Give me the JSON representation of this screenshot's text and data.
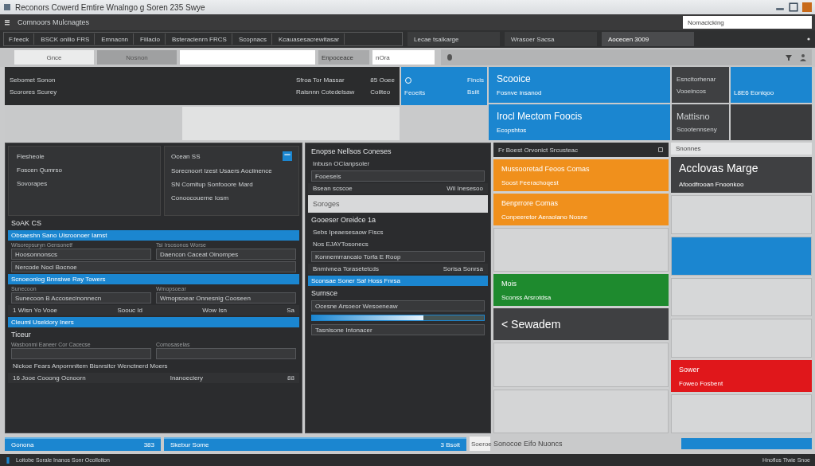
{
  "window": {
    "title": "Reconors Cowerd Emtire Wnalngo g Soren 235 Swye"
  },
  "app_bar": {
    "title": "Comnoors Mulcnagtes",
    "search": {
      "value": "Nomacicking"
    }
  },
  "toolbar": {
    "items": [
      "F.feeck",
      "BSCK onilio FRS",
      "Emnacnn",
      "Fiilacio",
      "Bsteracienrn FRCS",
      "Scopnacs",
      "Kcauasesacrewitasar"
    ],
    "tabs": [
      {
        "label": "Lecae tsalkarge",
        "selected": false
      },
      {
        "label": "Wrasoer Sacsa",
        "selected": false
      },
      {
        "label": "Aocecen 3009",
        "selected": true
      }
    ]
  },
  "filter_row": {
    "tabs": [
      {
        "label": "Gnce",
        "selected": true
      },
      {
        "label": "Nosnon",
        "selected": false
      }
    ],
    "field_label": "Enpoceace",
    "field_value": "nOra"
  },
  "info_panel": {
    "left": [
      "Sebomet Sonon",
      "Scorores Scurey"
    ],
    "middle": [
      "Sfroa Tor Massar",
      "Raisnnn Cotedelsaw"
    ],
    "right": [
      "85 Ooee",
      "Coilteo"
    ]
  },
  "side_tile": {
    "label": "Feoeits",
    "lines": [
      "Fincis",
      "Bsiit"
    ]
  },
  "blue_tiles": [
    {
      "title": "Scooice",
      "subtitle": "Fosnve insanod"
    },
    {
      "title": "Irocl Mectom Foocis",
      "subtitle": "Ecopshtos"
    }
  ],
  "dark_tiles": [
    {
      "title": "Esncitorhenar",
      "subtitle": "Vooeincos"
    },
    {
      "title": "Mattisno",
      "subtitle": "Scootennseny"
    }
  ],
  "accent_tile": {
    "label": "L8E6 Eoniqoo"
  },
  "left_panel": {
    "list": [
      "Fiesheole",
      "Foscen Qumrso",
      "Sovorapes"
    ],
    "detail": {
      "title": "Ocean SS",
      "lines": [
        "Sorecnoort Izest Usaers Aociinence",
        "SN Comitup Sonfooore Mard",
        "Conoocouerne Iosm"
      ]
    },
    "rows": [
      {
        "kind": "heading",
        "text": "SoAK CS"
      },
      {
        "kind": "bar",
        "text": "Obsaeshn Sano Uisroonoer Iamst"
      },
      {
        "kind": "fields",
        "items": [
          {
            "label": "Wisorepsuryn Gensonetf",
            "value": "Hoosonnonscs"
          },
          {
            "label": "Tsi Irsosonos Worse",
            "value": "Daencon Caceat Oinompes"
          }
        ]
      },
      {
        "kind": "field",
        "value": "Nercode Nocl Bocnoe"
      },
      {
        "kind": "bar",
        "text": "Scnoeonlog Bnnsiwe Ray Towers"
      },
      {
        "kind": "fields",
        "items": [
          {
            "label": "Sunecoon",
            "value": "Sunecoon B Accosecinonnecn"
          },
          {
            "label": "Wmopsoear",
            "value": "Wmopsoear Onnesnig Cooseen"
          }
        ]
      },
      {
        "kind": "columns",
        "cells": [
          "1 Wisn Yo Vooe",
          "Soouc Id",
          "Wow Isn",
          "Sa"
        ]
      },
      {
        "kind": "bar",
        "text": "Cleuml Useldory Iners"
      },
      {
        "kind": "heading",
        "text": "Ticeur"
      },
      {
        "kind": "fields",
        "items": [
          {
            "label": "Wasbonmi Eaneer Cor Cacecse"
          },
          {
            "label": "Comosaselas"
          }
        ]
      },
      {
        "kind": "text",
        "text": "Nickoe Fears Anpornnitem Bisnrsitcr Wenctnerd Moers"
      },
      {
        "kind": "columns",
        "cells": [
          "16 Jooe Cooong Ocnoorn",
          "Inanoeciery",
          "88"
        ]
      }
    ]
  },
  "middle_panel": {
    "rows": [
      {
        "kind": "heading",
        "text": "Enopse Nellsos Coneses"
      },
      {
        "kind": "text",
        "text": "Inbusn OCIanpsoler"
      },
      {
        "kind": "field",
        "value": "Fooeseis"
      },
      {
        "kind": "columns",
        "cells": [
          "Bsean scscoe",
          "Wil Inesesoo"
        ]
      },
      {
        "kind": "light",
        "text": "Soroges"
      },
      {
        "kind": "heading",
        "text": "Gooeser Oreidce 1a"
      },
      {
        "kind": "text",
        "text": "Sebs Ipeaesesaow Fiscs"
      },
      {
        "kind": "text",
        "text": "Nos EJAYTosonecs"
      },
      {
        "kind": "field",
        "value": "Konnemrrancaio Torfa E Roop"
      },
      {
        "kind": "columns",
        "cells": [
          "Bnmivnea Torasetetcds",
          "Sorisa Sonrsa"
        ]
      },
      {
        "kind": "bar",
        "text": "Sconsae Soner Saf Hoss Fnrsa"
      },
      {
        "kind": "heading",
        "text": "Surnsce"
      },
      {
        "kind": "field",
        "value": "Ocesne Arsoeor Wesoeneaw"
      },
      {
        "kind": "progress",
        "level": 0.65
      },
      {
        "kind": "field",
        "value": "Tasnisone Intonacer"
      }
    ]
  },
  "cards_panel": {
    "header": "Fr Boest Orvonict Srcusteac",
    "cards": [
      {
        "kind": "normal",
        "color": "#f0901c",
        "title": "Mussooretad Feoos Comas",
        "subtitle": "Soost Feerachoqest"
      },
      {
        "kind": "normal",
        "color": "#f0901c",
        "title": "Benprrore Comas",
        "subtitle": "Conpeeretor Aeraolano Nosne"
      },
      {
        "kind": "empty",
        "color": "#d4d5d6"
      },
      {
        "kind": "normal",
        "color": "#1e8a2e",
        "title": "Mois",
        "subtitle": "Sconss Arsrotdsa"
      },
      {
        "kind": "large",
        "color": "#3f4042",
        "title": "< Sewadem"
      },
      {
        "kind": "empty",
        "color": "#d4d5d6"
      },
      {
        "kind": "empty",
        "color": "#d4d5d6"
      }
    ]
  },
  "right_panel": {
    "header": "Snonnes",
    "cards": [
      {
        "kind": "large",
        "color": "#3f4042",
        "title": "Acclovas Marge",
        "subtitle": "Afoodfrooan Fnoonkoo"
      },
      {
        "kind": "empty",
        "color": "#d6d7d8"
      },
      {
        "kind": "empty",
        "color": "#1b86d0"
      },
      {
        "kind": "empty",
        "color": "#d6d7d8"
      },
      {
        "kind": "empty",
        "color": "#d6d7d8"
      },
      {
        "kind": "normal",
        "color": "#e0171b",
        "title": "Sower",
        "subtitle": "Foweo Fosbent"
      },
      {
        "kind": "empty",
        "color": "#d6d7d8"
      }
    ]
  },
  "bottom_bar": {
    "left": {
      "label": "Gonona",
      "count": "383"
    },
    "middle": {
      "label": "Skebur Some",
      "count": "3 Bsoit"
    },
    "tab": "Soeroe",
    "text": "Sonocoe Eifo Nuoncs"
  },
  "status_bar": {
    "left": "Loitobe Sorale Inanos Sonr Ocolloiton",
    "right": "Hnoflos Tiwie Snoe"
  }
}
